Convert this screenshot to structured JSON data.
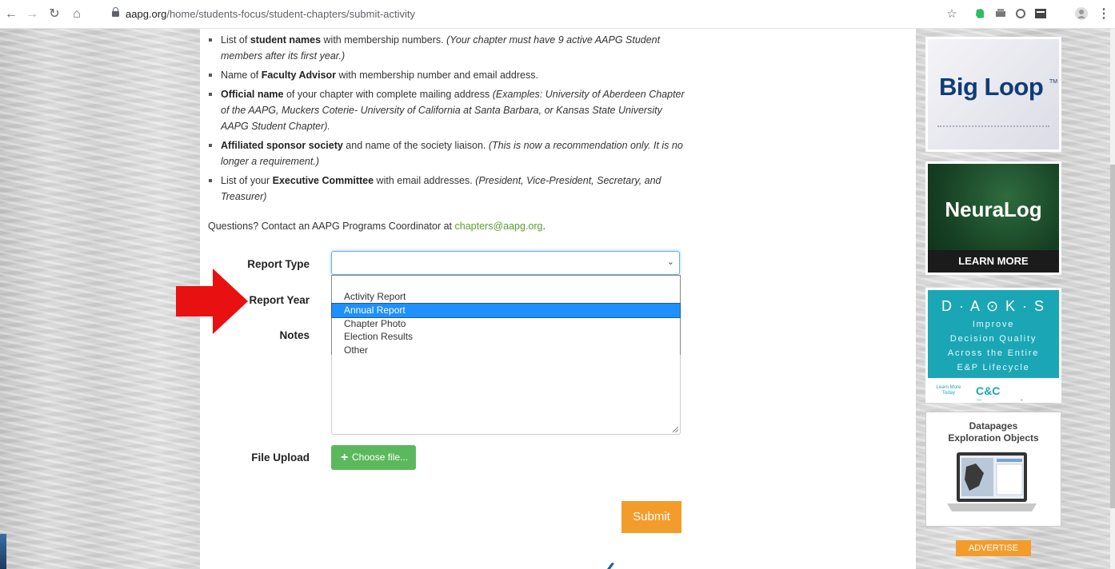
{
  "browser": {
    "url_domain": "aapg.org",
    "url_path": "/home/students-focus/student-chapters/submit-activity"
  },
  "requirements": [
    {
      "pre": "List of ",
      "bold": "student names",
      "mid": " with membership numbers. ",
      "italic": "(Your chapter must have 9 active AAPG Student members after its first year.)"
    },
    {
      "pre": "Name of ",
      "bold": "Faculty Advisor",
      "mid": " with membership number and email address.",
      "italic": ""
    },
    {
      "pre": "",
      "bold": "Official name",
      "mid": " of your chapter with complete mailing address ",
      "italic": "(Examples: University of Aberdeen Chapter of the AAPG, Muckers Coterie- University of California at Santa Barbara, or Kansas State University AAPG Student Chapter)."
    },
    {
      "pre": "",
      "bold": "Affiliated sponsor society",
      "mid": " and name of the society liaison. ",
      "italic": "(This is now a recommendation only. It is no longer a requirement.)"
    },
    {
      "pre": "List of your ",
      "bold": "Executive Committee",
      "mid": " with email addresses. ",
      "italic": "(President, Vice-President, Secretary, and Treasurer)"
    }
  ],
  "questions": {
    "text": "Questions? Contact an AAPG Programs Coordinator at ",
    "email": "chapters@aapg.org",
    "suffix": "."
  },
  "form": {
    "report_type_label": "Report Type",
    "report_year_label": "Report Year",
    "notes_label": "Notes",
    "file_upload_label": "File Upload",
    "choose_file_label": "Choose file...",
    "submit_label": "Submit",
    "report_type_options": [
      "Activity Report",
      "Annual Report",
      "Chapter Photo",
      "Election Results",
      "Other"
    ],
    "highlighted_option": "Annual Report"
  },
  "ads": {
    "big_loop": "Big Loop",
    "big_loop_tm": "TM",
    "neuralog": "NeuraLog",
    "neuralog_cta": "LEARN MORE",
    "daks_logo": "D · A ⊙ K · S",
    "daks_lines": [
      "Improve",
      "Decision Quality",
      "Across the Entire",
      "E&P Lifecycle"
    ],
    "daks_cta": "Learn More Today",
    "daks_company": "C&C Reservoirs",
    "datapages_line1": "Datapages",
    "datapages_line2": "Exploration Objects",
    "advertise": "ADVERTISE"
  },
  "colors": {
    "accent_orange": "#f39c2b",
    "link_green": "#5a9e2f",
    "button_green": "#5cb85c",
    "highlight_blue": "#1e90ff",
    "arrow_red": "#e81010"
  }
}
